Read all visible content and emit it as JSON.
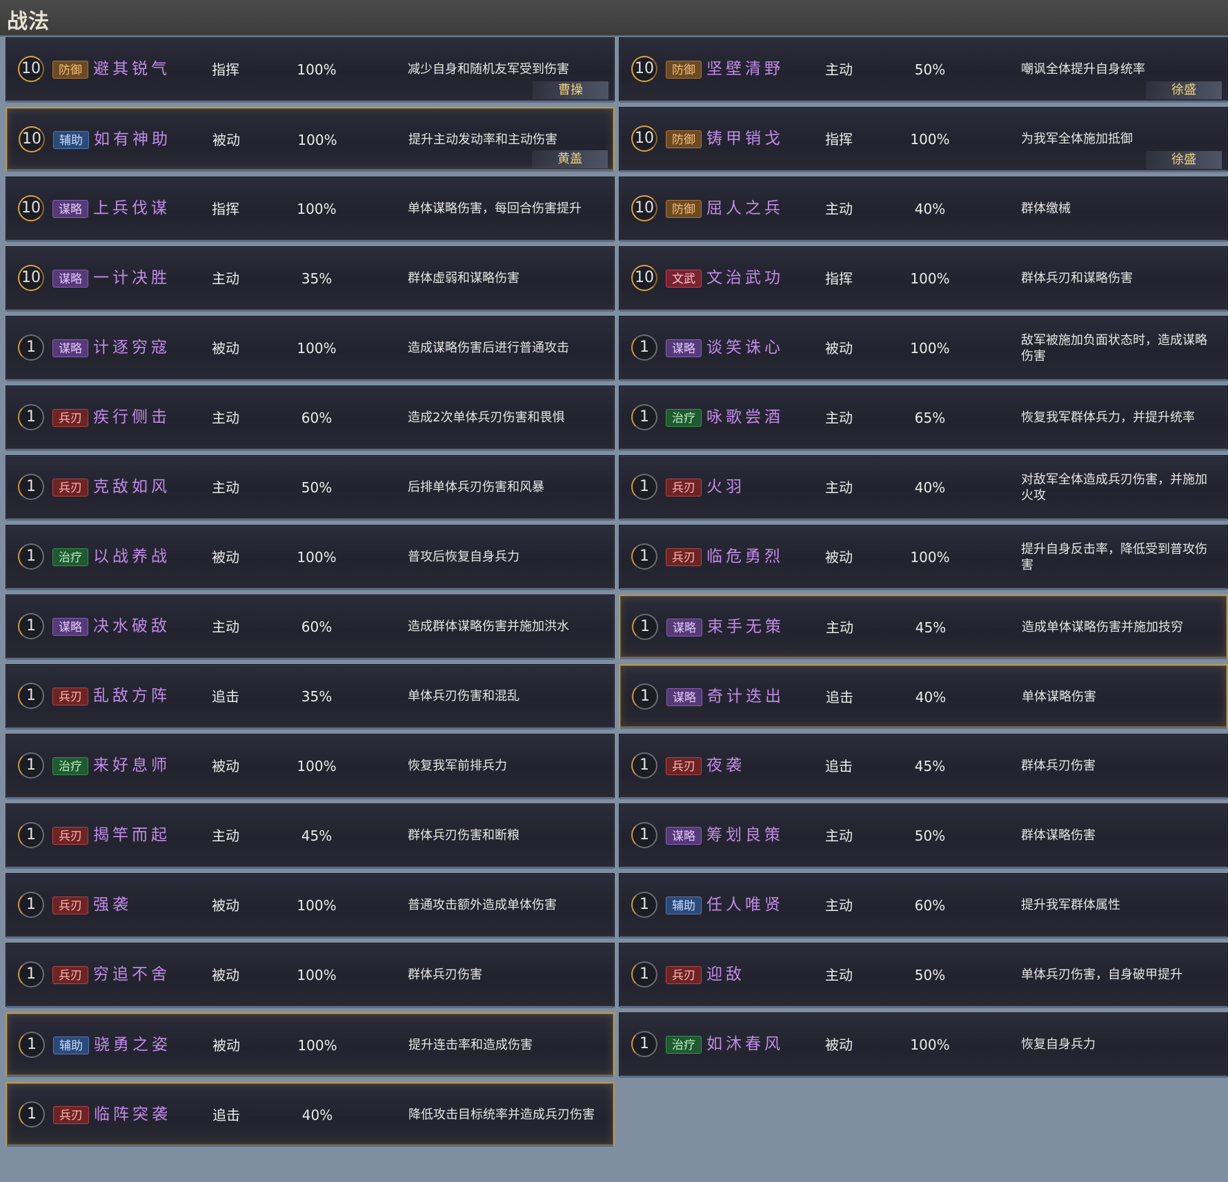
{
  "page": {
    "title": "战法"
  },
  "colors": {
    "name": "#c18be8",
    "highlight_border": "#b59a58",
    "owner_text": "#f2d27c"
  },
  "columns": [
    {
      "rows": [
        {
          "level": "10",
          "tag": "防御",
          "tag_type": "def",
          "name": "避其锐气",
          "kind": "指挥",
          "rate": "100%",
          "desc": "减少自身和随机友军受到伤害",
          "owner": "曹操",
          "highlight": false
        },
        {
          "level": "10",
          "tag": "辅助",
          "tag_type": "assist",
          "name": "如有神助",
          "kind": "被动",
          "rate": "100%",
          "desc": "提升主动发动率和主动伤害",
          "owner": "黄盖",
          "highlight": true
        },
        {
          "level": "10",
          "tag": "谋略",
          "tag_type": "strat",
          "name": "上兵伐谋",
          "kind": "指挥",
          "rate": "100%",
          "desc": "单体谋略伤害，每回合伤害提升",
          "owner": "",
          "highlight": false
        },
        {
          "level": "10",
          "tag": "谋略",
          "tag_type": "strat",
          "name": "一计决胜",
          "kind": "主动",
          "rate": "35%",
          "desc": "群体虚弱和谋略伤害",
          "owner": "",
          "highlight": false
        },
        {
          "level": "1",
          "tag": "谋略",
          "tag_type": "strat",
          "name": "计逐穷寇",
          "kind": "被动",
          "rate": "100%",
          "desc": "造成谋略伤害后进行普通攻击",
          "owner": "",
          "highlight": false
        },
        {
          "level": "1",
          "tag": "兵刃",
          "tag_type": "blade",
          "name": "疾行侧击",
          "kind": "主动",
          "rate": "60%",
          "desc": "造成2次单体兵刃伤害和畏惧",
          "owner": "",
          "highlight": false
        },
        {
          "level": "1",
          "tag": "兵刃",
          "tag_type": "blade",
          "name": "克敌如风",
          "kind": "主动",
          "rate": "50%",
          "desc": "后排单体兵刃伤害和风暴",
          "owner": "",
          "highlight": false
        },
        {
          "level": "1",
          "tag": "治疗",
          "tag_type": "heal",
          "name": "以战养战",
          "kind": "被动",
          "rate": "100%",
          "desc": "普攻后恢复自身兵力",
          "owner": "",
          "highlight": false
        },
        {
          "level": "1",
          "tag": "谋略",
          "tag_type": "strat",
          "name": "决水破敌",
          "kind": "主动",
          "rate": "60%",
          "desc": "造成群体谋略伤害并施加洪水",
          "owner": "",
          "highlight": false
        },
        {
          "level": "1",
          "tag": "兵刃",
          "tag_type": "blade",
          "name": "乱敌方阵",
          "kind": "追击",
          "rate": "35%",
          "desc": "单体兵刃伤害和混乱",
          "owner": "",
          "highlight": false
        },
        {
          "level": "1",
          "tag": "治疗",
          "tag_type": "heal",
          "name": "来好息师",
          "kind": "被动",
          "rate": "100%",
          "desc": "恢复我军前排兵力",
          "owner": "",
          "highlight": false
        },
        {
          "level": "1",
          "tag": "兵刃",
          "tag_type": "blade",
          "name": "揭竿而起",
          "kind": "主动",
          "rate": "45%",
          "desc": "群体兵刃伤害和断粮",
          "owner": "",
          "highlight": false
        },
        {
          "level": "1",
          "tag": "兵刃",
          "tag_type": "blade",
          "name": "强袭",
          "kind": "被动",
          "rate": "100%",
          "desc": "普通攻击额外造成单体伤害",
          "owner": "",
          "highlight": false
        },
        {
          "level": "1",
          "tag": "兵刃",
          "tag_type": "blade",
          "name": "穷追不舍",
          "kind": "被动",
          "rate": "100%",
          "desc": "群体兵刃伤害",
          "owner": "",
          "highlight": false
        },
        {
          "level": "1",
          "tag": "辅助",
          "tag_type": "assist",
          "name": "骁勇之姿",
          "kind": "被动",
          "rate": "100%",
          "desc": "提升连击率和造成伤害",
          "owner": "",
          "highlight": true
        },
        {
          "level": "1",
          "tag": "兵刃",
          "tag_type": "blade",
          "name": "临阵突袭",
          "kind": "追击",
          "rate": "40%",
          "desc": "降低攻击目标统率并造成兵刃伤害",
          "owner": "",
          "highlight": true
        }
      ]
    },
    {
      "rows": [
        {
          "level": "10",
          "tag": "防御",
          "tag_type": "def",
          "name": "坚壁清野",
          "kind": "主动",
          "rate": "50%",
          "desc": "嘲讽全体提升自身统率",
          "owner": "徐盛",
          "highlight": false
        },
        {
          "level": "10",
          "tag": "防御",
          "tag_type": "def",
          "name": "铸甲销戈",
          "kind": "指挥",
          "rate": "100%",
          "desc": "为我军全体施加抵御",
          "owner": "徐盛",
          "highlight": false
        },
        {
          "level": "10",
          "tag": "防御",
          "tag_type": "def",
          "name": "屈人之兵",
          "kind": "主动",
          "rate": "40%",
          "desc": "群体缴械",
          "owner": "",
          "highlight": false
        },
        {
          "level": "10",
          "tag": "文武",
          "tag_type": "wen",
          "name": "文治武功",
          "kind": "指挥",
          "rate": "100%",
          "desc": "群体兵刃和谋略伤害",
          "owner": "",
          "highlight": false
        },
        {
          "level": "1",
          "tag": "谋略",
          "tag_type": "strat",
          "name": "谈笑诛心",
          "kind": "被动",
          "rate": "100%",
          "desc": "敌军被施加负面状态时，造成谋略伤害",
          "owner": "",
          "highlight": false
        },
        {
          "level": "1",
          "tag": "治疗",
          "tag_type": "heal",
          "name": "咏歌尝酒",
          "kind": "主动",
          "rate": "65%",
          "desc": "恢复我军群体兵力，并提升统率",
          "owner": "",
          "highlight": false
        },
        {
          "level": "1",
          "tag": "兵刃",
          "tag_type": "blade",
          "name": "火羽",
          "kind": "主动",
          "rate": "40%",
          "desc": "对敌军全体造成兵刃伤害，并施加火攻",
          "owner": "",
          "highlight": false
        },
        {
          "level": "1",
          "tag": "兵刃",
          "tag_type": "blade",
          "name": "临危勇烈",
          "kind": "被动",
          "rate": "100%",
          "desc": "提升自身反击率，降低受到普攻伤害",
          "owner": "",
          "highlight": false
        },
        {
          "level": "1",
          "tag": "谋略",
          "tag_type": "strat",
          "name": "束手无策",
          "kind": "主动",
          "rate": "45%",
          "desc": "造成单体谋略伤害并施加技穷",
          "owner": "",
          "highlight": true
        },
        {
          "level": "1",
          "tag": "谋略",
          "tag_type": "strat",
          "name": "奇计迭出",
          "kind": "追击",
          "rate": "40%",
          "desc": "单体谋略伤害",
          "owner": "",
          "highlight": true
        },
        {
          "level": "1",
          "tag": "兵刃",
          "tag_type": "blade",
          "name": "夜袭",
          "kind": "追击",
          "rate": "45%",
          "desc": "群体兵刃伤害",
          "owner": "",
          "highlight": false
        },
        {
          "level": "1",
          "tag": "谋略",
          "tag_type": "strat",
          "name": "筹划良策",
          "kind": "主动",
          "rate": "50%",
          "desc": "群体谋略伤害",
          "owner": "",
          "highlight": false
        },
        {
          "level": "1",
          "tag": "辅助",
          "tag_type": "assist",
          "name": "任人唯贤",
          "kind": "主动",
          "rate": "60%",
          "desc": "提升我军群体属性",
          "owner": "",
          "highlight": false
        },
        {
          "level": "1",
          "tag": "兵刃",
          "tag_type": "blade",
          "name": "迎敌",
          "kind": "主动",
          "rate": "50%",
          "desc": "单体兵刃伤害，自身破甲提升",
          "owner": "",
          "highlight": false
        },
        {
          "level": "1",
          "tag": "治疗",
          "tag_type": "heal",
          "name": "如沐春风",
          "kind": "被动",
          "rate": "100%",
          "desc": "恢复自身兵力",
          "owner": "",
          "highlight": false
        }
      ]
    }
  ]
}
